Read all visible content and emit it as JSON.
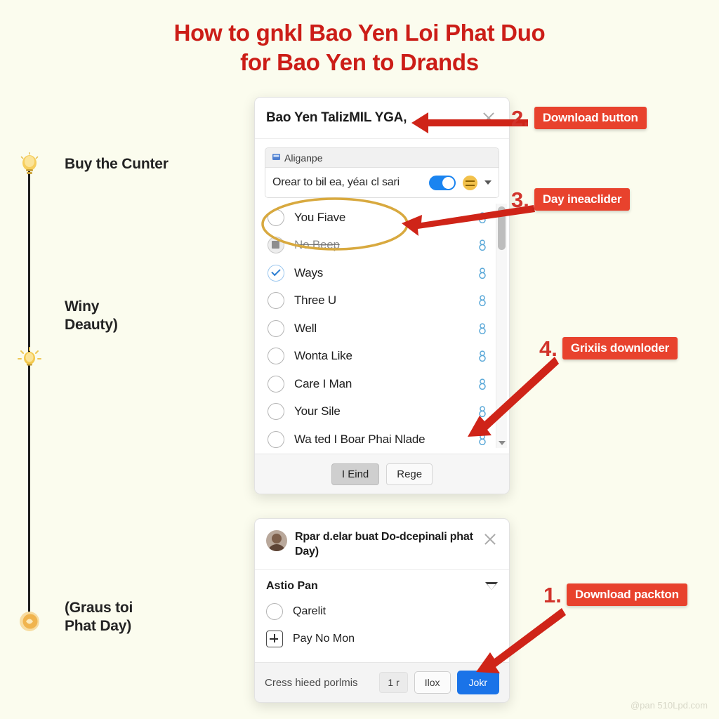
{
  "page": {
    "title_line1": "How to gnkl Bao Yen Loi Phat Duo",
    "title_line2": "for Bao Yen to Drands",
    "watermark": "@pan 510Lpd.com",
    "accent_red": "#cc1d17",
    "pill_red": "#e8422d",
    "background": "#fbfcee"
  },
  "timeline": {
    "steps": [
      {
        "icon": "lightbulb-icon",
        "label": "Buy the Cunter"
      },
      {
        "icon": "lightbulb-icon",
        "label": "Winy\nDeauty)"
      },
      {
        "icon": "coin-icon",
        "label": "(Graus toi\nPhat Day)"
      }
    ],
    "step1_label": "Buy the Cunter",
    "step2_label_line1": "Winy",
    "step2_label_line2": "Deauty)",
    "step3_label_line1": "(Graus toi",
    "step3_label_line2": "Phat Day)"
  },
  "dialog_main": {
    "title": "Bao Yen TalizMIL YGA,",
    "close_icon": "close-icon",
    "subpanel": {
      "header": "Aliganpe",
      "header_icon": "app-icon",
      "row_label": "Orear to bil ea, yéaı cl sari",
      "toggle_on": true,
      "emoji_icon": "confused-face-icon",
      "caret_icon": "chevron-down-icon"
    },
    "list": [
      {
        "label": "You Fiave",
        "state": "unchecked",
        "trailing_icon": "person-icon"
      },
      {
        "label": "No Beep",
        "state": "disabled",
        "trailing_icon": "person-icon"
      },
      {
        "label": "Ways",
        "state": "checked",
        "trailing_icon": "person-icon"
      },
      {
        "label": "Three U",
        "state": "unchecked",
        "trailing_icon": "person-icon"
      },
      {
        "label": "Well",
        "state": "unchecked",
        "trailing_icon": "person-icon"
      },
      {
        "label": "Wonta Like",
        "state": "unchecked",
        "trailing_icon": "person-icon"
      },
      {
        "label": "Care I Man",
        "state": "unchecked",
        "trailing_icon": "person-icon"
      },
      {
        "label": "Your Sile",
        "state": "unchecked",
        "trailing_icon": "person-icon"
      },
      {
        "label": "Wa ted I Boar Phai Nlade",
        "state": "unchecked",
        "trailing_icon": "person-icon"
      }
    ],
    "footer": {
      "primary_label": "I Eind",
      "secondary_label": "Rege"
    }
  },
  "dialog_second": {
    "avatar": "user-avatar",
    "title_line1": "Rpar d.elar buat Do-dcepinali",
    "title_line2": "phat Day)",
    "close_icon": "close-icon",
    "section_label": "Astio Pan",
    "section_icon": "filter-triangle-icon",
    "rows": [
      {
        "label": "Qarelit",
        "control": "radio"
      },
      {
        "label": "Pay No Mon",
        "control": "plus"
      }
    ],
    "footer": {
      "note": "Cress hieed porlmis",
      "chip": "1 r",
      "secondary_label": "Ilox",
      "primary_label": "Jokr"
    }
  },
  "annotations": [
    {
      "num": "1.",
      "label": "Download packton"
    },
    {
      "num": "2.",
      "label": "Download button"
    },
    {
      "num": "3.",
      "label": "Day ineaclider"
    },
    {
      "num": "4.",
      "label": "Grixiis downloder"
    }
  ]
}
